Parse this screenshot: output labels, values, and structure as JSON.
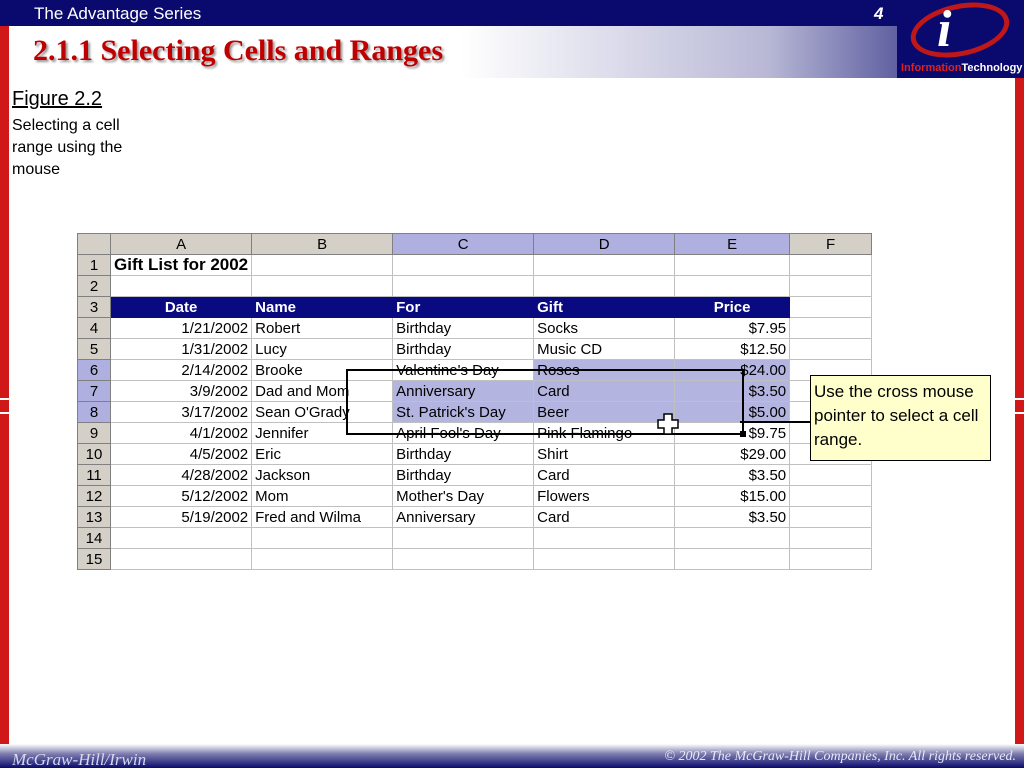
{
  "header": {
    "series": "The Advantage Series",
    "slide_number": "4",
    "title": "2.1.1 Selecting Cells and Ranges",
    "logo_text_red": "Information",
    "logo_text_white": "Technology"
  },
  "figure": {
    "label": "Figure 2.2",
    "caption": "Selecting a cell range using the mouse"
  },
  "sheet": {
    "columns": [
      "A",
      "B",
      "C",
      "D",
      "E",
      "F"
    ],
    "selected_columns": [
      "C",
      "D",
      "E"
    ],
    "selected_rows": [
      "6",
      "7",
      "8"
    ],
    "title": "Gift List for 2002",
    "headers": [
      "Date",
      "Name",
      "For",
      "Gift",
      "Price"
    ],
    "rows": [
      [
        "1/21/2002",
        "Robert",
        "Birthday",
        "Socks",
        "$7.95"
      ],
      [
        "1/31/2002",
        "Lucy",
        "Birthday",
        "Music CD",
        "$12.50"
      ],
      [
        "2/14/2002",
        "Brooke",
        "Valentine's Day",
        "Roses",
        "$24.00"
      ],
      [
        "3/9/2002",
        "Dad and Mom",
        "Anniversary",
        "Card",
        "$3.50"
      ],
      [
        "3/17/2002",
        "Sean O'Grady",
        "St. Patrick's Day",
        "Beer",
        "$5.00"
      ],
      [
        "4/1/2002",
        "Jennifer",
        "April Fool's Day",
        "Pink Flamingo",
        "$9.75"
      ],
      [
        "4/5/2002",
        "Eric",
        "Birthday",
        "Shirt",
        "$29.00"
      ],
      [
        "4/28/2002",
        "Jackson",
        "Birthday",
        "Card",
        "$3.50"
      ],
      [
        "5/12/2002",
        "Mom",
        "Mother's Day",
        "Flowers",
        "$15.00"
      ],
      [
        "5/19/2002",
        "Fred and Wilma",
        "Anniversary",
        "Card",
        "$3.50"
      ]
    ],
    "row_numbers": [
      "1",
      "2",
      "3",
      "4",
      "5",
      "6",
      "7",
      "8",
      "9",
      "10",
      "11",
      "12",
      "13",
      "14",
      "15"
    ]
  },
  "callout": {
    "text": "Use the cross mouse pointer to select a cell range."
  },
  "footer": {
    "left": "McGraw-Hill/Irwin",
    "right": "© 2002 The McGraw-Hill Companies, Inc. All rights reserved."
  },
  "colors": {
    "navy": "#0a0a6e",
    "title_red": "#c00000",
    "stripe_red": "#d01818",
    "selection": "#b4b4e0",
    "callout_bg": "#ffffcc"
  }
}
